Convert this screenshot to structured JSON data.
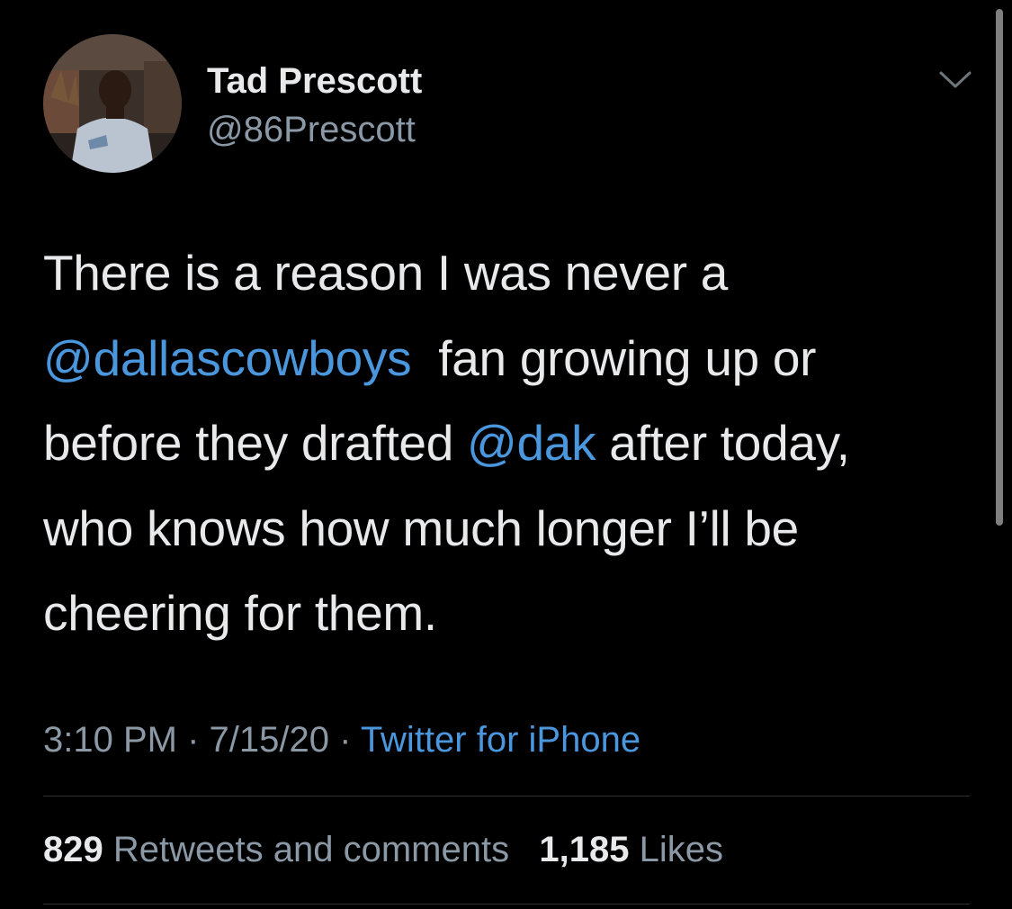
{
  "tweet": {
    "author": {
      "display_name": "Tad Prescott",
      "handle": "@86Prescott",
      "avatar": "profile-photo"
    },
    "text_lines": [
      [
        {
          "t": "There is a reason I was never a"
        }
      ],
      [
        {
          "t": "@dallascowboys",
          "mention": true
        },
        {
          "t": "  fan growing up or"
        }
      ],
      [
        {
          "t": "before they drafted "
        },
        {
          "t": "@dak",
          "mention": true
        },
        {
          "t": " after today,"
        }
      ],
      [
        {
          "t": "who knows how much longer I’ll be"
        }
      ],
      [
        {
          "t": "cheering for them."
        }
      ]
    ],
    "meta": {
      "time": "3:10 PM",
      "separator": " · ",
      "date": "7/15/20",
      "source": "Twitter for iPhone"
    },
    "stats": {
      "retweets_count": "829",
      "retweets_label": "Retweets and comments",
      "likes_count": "1,185",
      "likes_label": "Likes"
    },
    "menu_icon": "chevron-down-icon"
  },
  "colors": {
    "background": "#000000",
    "text": "#e7e9ea",
    "secondary": "#8b98a5",
    "accent": "#4a97dd",
    "divider": "#2f3336"
  }
}
